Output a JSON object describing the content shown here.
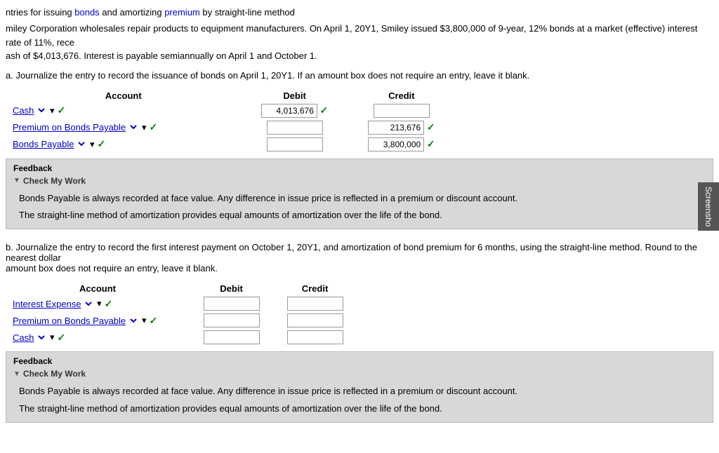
{
  "page": {
    "intro": {
      "line1": "ntries for issuing bonds and amortizing premium by straight-line method",
      "bond_link": "bonds",
      "premium_link": "premium",
      "description": "miley Corporation wholesales repair products to equipment manufacturers. On April 1, 20Y1, Smiley issued $3,800,000 of 9-year, 12% bonds at a market (effective) interest rate of 11%, rece",
      "description2": "ash of $4,013,676. Interest is payable semiannually on April 1 and October 1."
    },
    "part_a": {
      "question": "a. Journalize the entry to record the issuance of bonds on April 1, 20Y1. If an amount box does not require an entry, leave it blank.",
      "table": {
        "headers": [
          "Account",
          "Debit",
          "Credit"
        ],
        "rows": [
          {
            "account": "Cash",
            "account_style": "link",
            "debit_value": "4,013,676",
            "debit_checked": true,
            "credit_value": "",
            "credit_checked": false,
            "account_checked": true
          },
          {
            "account": "Premium on Bonds Payable",
            "account_style": "link",
            "debit_value": "",
            "debit_checked": false,
            "credit_value": "213,676",
            "credit_checked": true,
            "account_checked": true
          },
          {
            "account": "Bonds Payable",
            "account_style": "link",
            "debit_value": "",
            "debit_checked": false,
            "credit_value": "3,800,000",
            "credit_checked": true,
            "account_checked": true
          }
        ]
      },
      "feedback": {
        "label": "Feedback",
        "check_my_work": "Check My Work",
        "lines": [
          "Bonds Payable is always recorded at face value. Any difference in issue price is reflected in a premium or discount account.",
          "The straight-line method of amortization provides equal amounts of amortization over the life of the bond."
        ]
      }
    },
    "part_b": {
      "question": "b. Journalize the entry to record the first interest payment on October 1, 20Y1, and amortization of bond premium for 6 months, using the straight-line method. Round to the nearest dollar",
      "question2": "amount box does not require an entry, leave it blank.",
      "table": {
        "headers": [
          "Account",
          "Debit",
          "Credit"
        ],
        "rows": [
          {
            "account": "Interest Expense",
            "account_style": "link",
            "debit_value": "",
            "credit_value": "",
            "account_checked": true
          },
          {
            "account": "Premium on Bonds Payable",
            "account_style": "link",
            "debit_value": "",
            "credit_value": "",
            "account_checked": true
          },
          {
            "account": "Cash",
            "account_style": "link",
            "debit_value": "",
            "credit_value": "",
            "account_checked": true
          }
        ]
      },
      "feedback": {
        "label": "Feedback",
        "check_my_work": "Check My Work",
        "lines": [
          "Bonds Payable is always recorded at face value. Any difference in issue price is reflected in a premium or discount account.",
          "The straight-line method of amortization provides equal amounts of amortization over the life of the bond."
        ]
      }
    },
    "screenshot_btn": "Screensho"
  }
}
